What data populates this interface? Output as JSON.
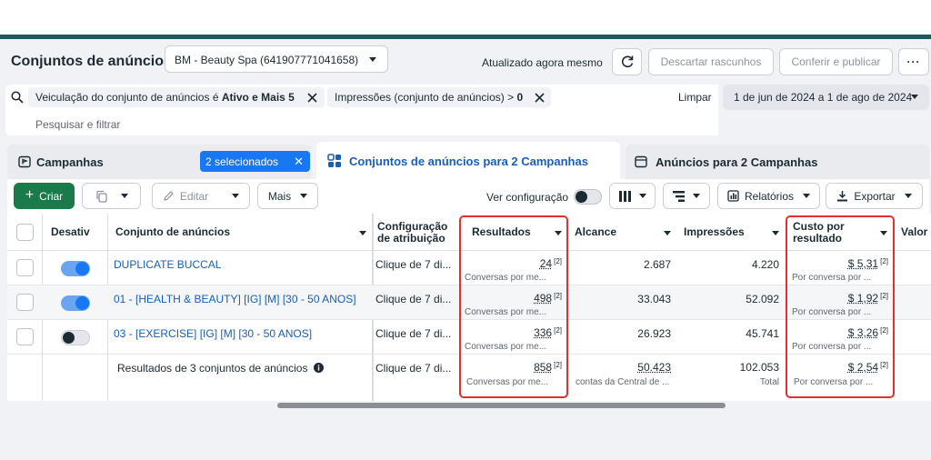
{
  "header": {
    "title": "Conjuntos de anúncios",
    "account_select": "BM - Beauty Spa (641907771041658)",
    "updated_text": "Atualizado agora mesmo",
    "discard_label": "Descartar rascunhos",
    "publish_label": "Conferir e publicar",
    "more_label": "···"
  },
  "filters": {
    "chip1_prefix": "Veiculação do conjunto de anúncios é ",
    "chip1_bold": "Ativo e Mais 5",
    "chip2_prefix": "Impressões (conjunto de anúncios) > ",
    "chip2_bold": "0",
    "search_placeholder": "Pesquisar e filtrar",
    "clear_label": "Limpar",
    "date_range": "1 de jun de 2024 a 1 de ago de 2024"
  },
  "tabs": {
    "campaigns_label": "Campanhas",
    "selected_badge": "2 selecionados",
    "adsets_label": "Conjuntos de anúncios para 2 Campanhas",
    "ads_label": "Anúncios para 2 Campanhas"
  },
  "toolbar": {
    "create_label": "Criar",
    "edit_label": "Editar",
    "more_label": "Mais",
    "view_config_label": "Ver configuração",
    "reports_label": "Relatórios",
    "export_label": "Exportar"
  },
  "table": {
    "headers": {
      "toggle": "Desativ",
      "name": "Conjunto de anúncios",
      "attribution": "Configuração de atribuição",
      "results": "Resultados",
      "reach": "Alcance",
      "impressions": "Impressões",
      "cost": "Custo por resultado",
      "value": "Valor"
    },
    "rows": [
      {
        "name": "DUPLICATE BUCCAL",
        "on": true,
        "attribution": "Clique de 7 di...",
        "results": "24",
        "results_sub": "Conversas por me...",
        "reach": "2.687",
        "impressions": "4.220",
        "cost": "$ 5,31",
        "cost_sub": "Por conversa por ..."
      },
      {
        "name": "01 - [HEALTH & BEAUTY] [IG] [M] [30 - 50 ANOS]",
        "on": true,
        "attribution": "Clique de 7 di...",
        "results": "498",
        "results_sub": "Conversas por me...",
        "reach": "33.043",
        "impressions": "52.092",
        "cost": "$ 1,92",
        "cost_sub": "Por conversa por ..."
      },
      {
        "name": "03 - [EXERCISE] [IG] [M] [30 - 50 ANOS]",
        "on": false,
        "attribution": "Clique de 7 di...",
        "results": "336",
        "results_sub": "Conversas por me...",
        "reach": "26.923",
        "impressions": "45.741",
        "cost": "$ 3,26",
        "cost_sub": "Por conversa por ..."
      }
    ],
    "summary": {
      "label": "Resultados de 3 conjuntos de anúncios",
      "attribution": "Clique de 7 di...",
      "results": "858",
      "results_sub": "Conversas por me...",
      "reach": "50.423",
      "reach_sub": "contas da Central de ...",
      "impressions": "102.053",
      "impressions_sub": "Total",
      "cost": "$ 2,54",
      "cost_sub": "Por conversa por ..."
    },
    "footnote_mark": "[2]"
  },
  "colors": {
    "accent": "#1877f2",
    "create_green": "#1a7a4a",
    "highlight": "#e03131",
    "top_border": "#1b5a5e"
  }
}
